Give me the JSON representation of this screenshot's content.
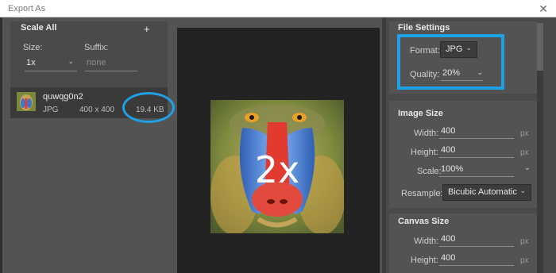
{
  "window": {
    "title": "Export As",
    "close_glyph": "✕"
  },
  "scale_all": {
    "heading": "Scale All",
    "size_label": "Size:",
    "suffix_label": "Suffix:",
    "size_value": "1x",
    "suffix_placeholder": "none",
    "add_glyph": "+"
  },
  "asset": {
    "name": "quwqg0n2",
    "format": "JPG",
    "dimensions": "400 x 400",
    "file_size": "19.4 KB"
  },
  "preview": {
    "overlay_text": "2x"
  },
  "file_settings": {
    "heading": "File Settings",
    "format_label": "Format:",
    "format_value": "JPG",
    "quality_label": "Quality:",
    "quality_value": "20%"
  },
  "image_size": {
    "heading": "Image Size",
    "width_label": "Width:",
    "width_value": "400",
    "height_label": "Height:",
    "height_value": "400",
    "scale_label": "Scale:",
    "scale_value": "100%",
    "resample_label": "Resample:",
    "resample_value": "Bicubic Automatic",
    "unit": "px"
  },
  "canvas_size": {
    "heading": "Canvas Size",
    "width_label": "Width:",
    "width_value": "400",
    "height_label": "Height:",
    "height_value": "400",
    "unit": "px"
  },
  "colors": {
    "accent_highlight": "#1ea1e6"
  },
  "icons": {
    "close": "close-icon",
    "add": "plus-icon",
    "dropdown": "chevron-down-icon"
  }
}
